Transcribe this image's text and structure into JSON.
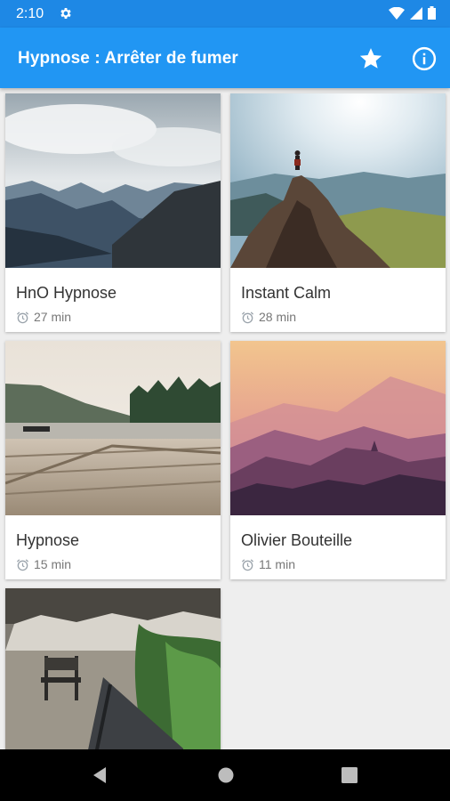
{
  "status_bar": {
    "time": "2:10"
  },
  "app_bar": {
    "title": "Hypnose : Arrêter de fumer"
  },
  "sessions": [
    {
      "title": "HnO Hypnose",
      "duration": "27 min",
      "image": "mountain-valley"
    },
    {
      "title": "Instant Calm",
      "duration": "28 min",
      "image": "hiker-on-peak"
    },
    {
      "title": "Hypnose",
      "duration": "15 min",
      "image": "wooden-dock-lake"
    },
    {
      "title": "Olivier Bouteille",
      "duration": "11 min",
      "image": "misty-sunset-hills"
    },
    {
      "title": "",
      "duration": "",
      "image": "garden-bench"
    }
  ],
  "icons": {
    "settings": "gear-icon",
    "favorites": "star-icon",
    "info": "info-icon",
    "duration": "alarm-clock-icon",
    "nav_back": "back-triangle-icon",
    "nav_home": "home-circle-icon",
    "nav_recents": "recents-square-icon"
  },
  "colors": {
    "status_bar": "#1e88e5",
    "app_bar": "#2196f3",
    "background": "#eeeeee"
  }
}
